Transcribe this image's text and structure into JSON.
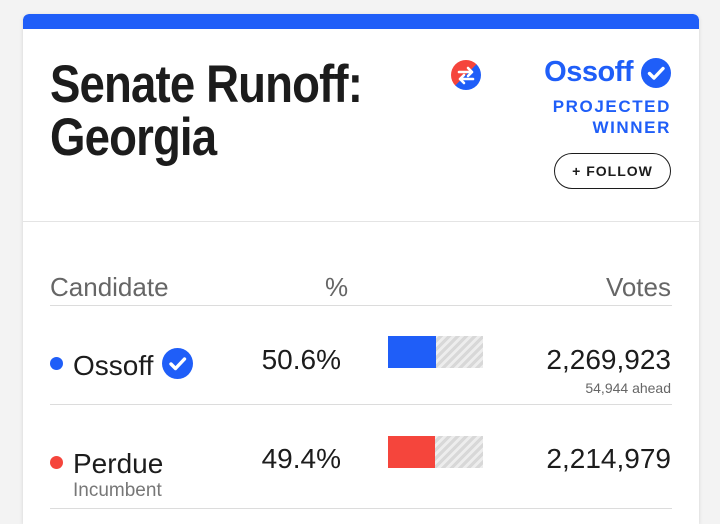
{
  "race": {
    "title_line1": "Senate Runoff:",
    "title_line2": "Georgia"
  },
  "winner": {
    "name": "Ossoff",
    "status_line1": "PROJECTED",
    "status_line2": "WINNER",
    "badge_icon": "party-switch-icon",
    "check_icon": "verified-check-icon"
  },
  "follow_button": {
    "label": "+ FOLLOW"
  },
  "table": {
    "headers": {
      "candidate": "Candidate",
      "percent": "%",
      "votes": "Votes"
    },
    "rows": [
      {
        "name": "Ossoff",
        "party_color": "#1f5ef8",
        "winner": true,
        "percent": "50.6%",
        "percent_value": 50.6,
        "votes": "2,269,923",
        "margin_note": "54,944 ahead"
      },
      {
        "name": "Perdue",
        "party_color": "#f5453c",
        "note": "Incumbent",
        "winner": false,
        "percent": "49.4%",
        "percent_value": 49.4,
        "votes": "2,214,979"
      }
    ]
  },
  "colors": {
    "accent": "#1f5ef8",
    "republican": "#f5453c",
    "democrat": "#1f5ef8"
  }
}
